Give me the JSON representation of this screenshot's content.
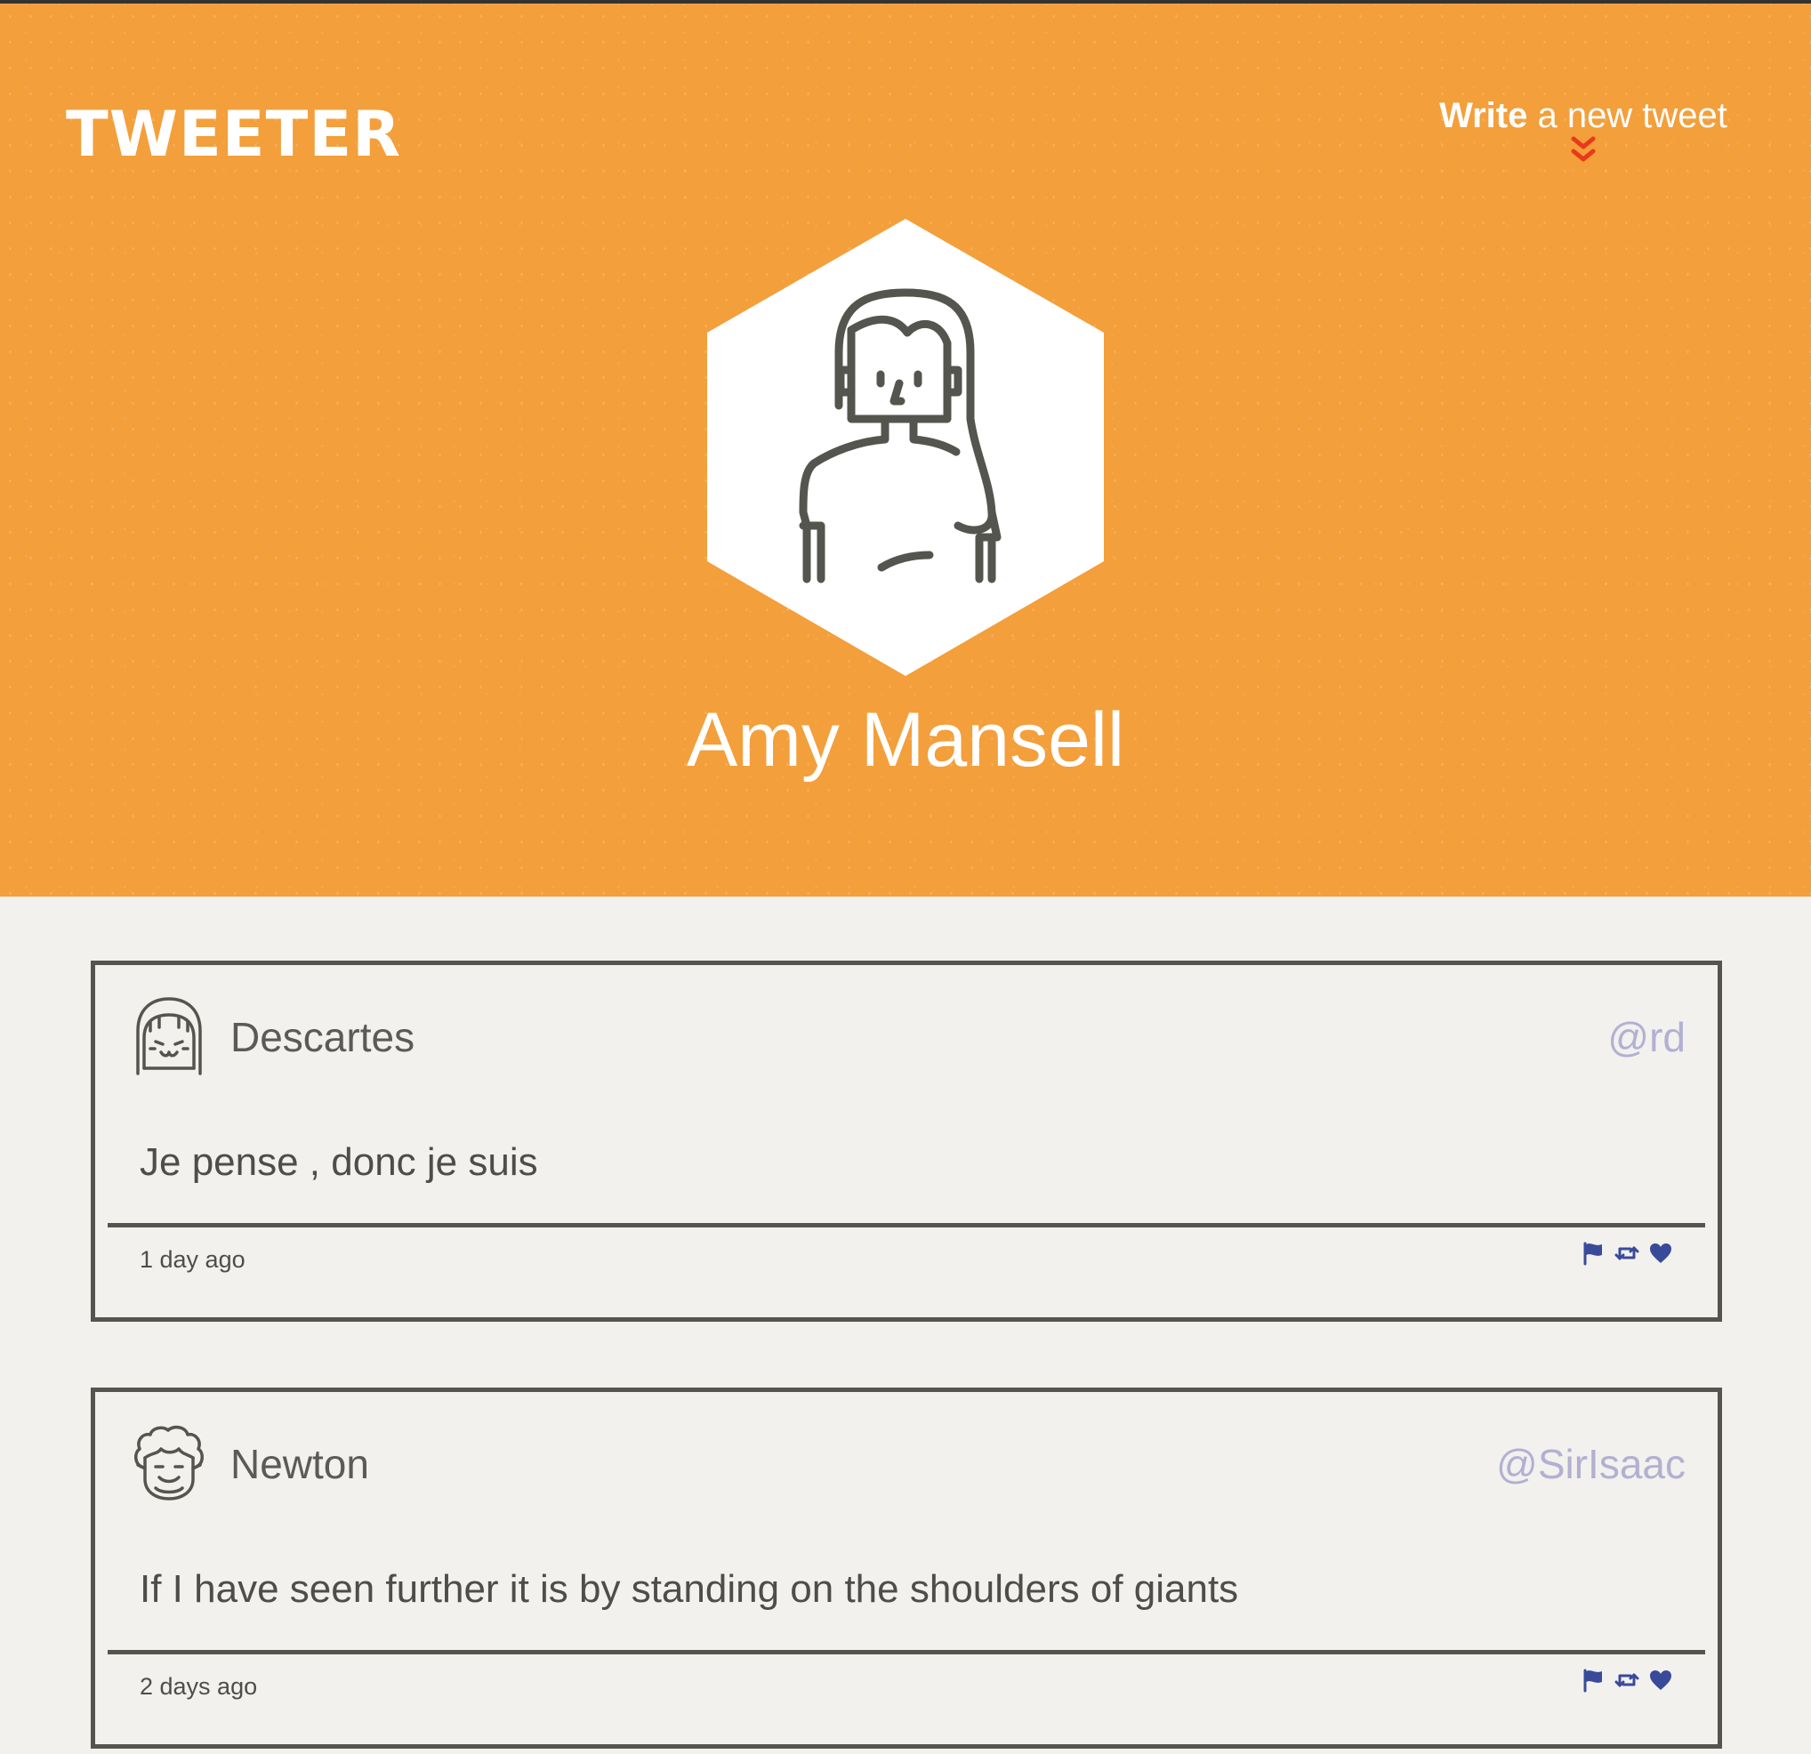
{
  "header": {
    "logo": "TWEETER",
    "compose_bold": "Write",
    "compose_rest": " a new tweet",
    "background_color": "#f39f3b",
    "chevron_color": "#e8391c"
  },
  "profile": {
    "name": "Amy Mansell",
    "avatar_icon": "woman-avatar-icon"
  },
  "tweets": [
    {
      "author": "Descartes",
      "handle": "@rd",
      "text": "Je pense , donc je suis",
      "time": "1 day ago",
      "avatar_icon": "girl-face-avatar-icon"
    },
    {
      "author": "Newton",
      "handle": "@SirIsaac",
      "text": "If I have seen further it is by standing on the shoulders of giants",
      "time": "2 days ago",
      "avatar_icon": "curly-hair-face-avatar-icon"
    }
  ],
  "actions": {
    "icons": [
      "flag-icon",
      "retweet-icon",
      "heart-icon"
    ],
    "color": "#3a4a9a"
  },
  "colors": {
    "handle": "#b2b0d2",
    "border": "#555550",
    "page_bg": "#f2f1ed"
  }
}
